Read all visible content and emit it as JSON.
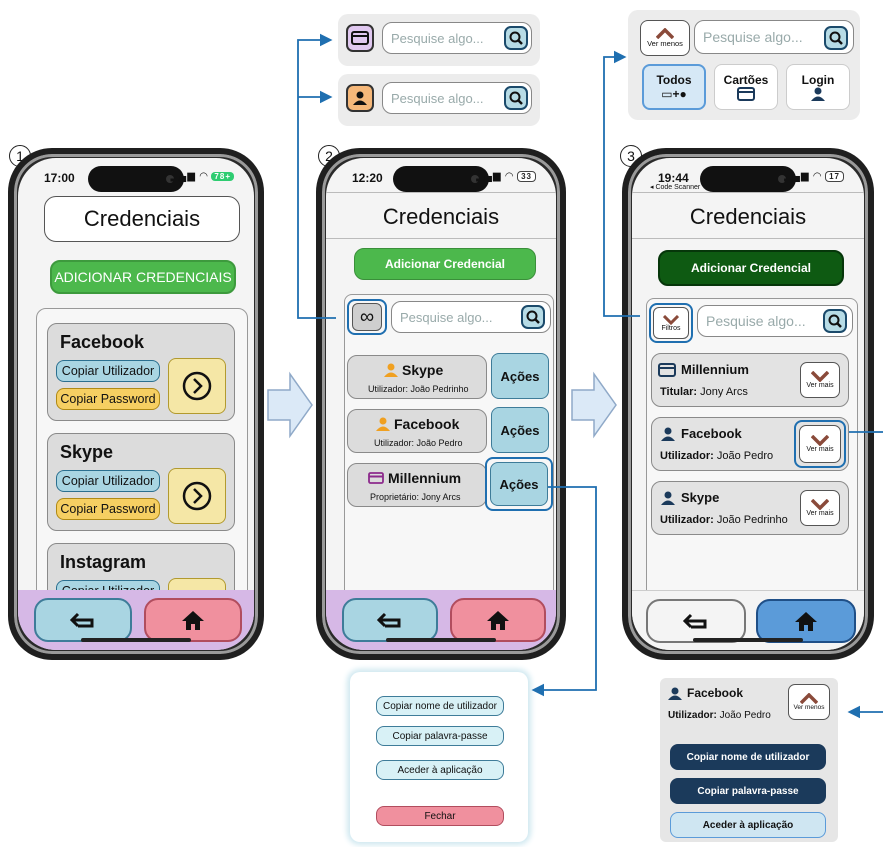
{
  "steps": {
    "s1": "1",
    "s2": "2",
    "s3": "3"
  },
  "phone1": {
    "time": "17:00",
    "battery": "78+",
    "title": "Credenciais",
    "add_button": "ADICIONAR CREDENCIAIS",
    "cards": [
      {
        "name": "Facebook",
        "copy_user": "Copiar Utilizador",
        "copy_pass": "Copiar Password"
      },
      {
        "name": "Skype",
        "copy_user": "Copiar Utilizador",
        "copy_pass": "Copiar Password"
      },
      {
        "name": "Instagram",
        "copy_user": "Copiar Utilizador"
      }
    ]
  },
  "phone2": {
    "time": "12:20",
    "battery": "33",
    "title": "Credenciais",
    "add_button": "Adicionar Credencial",
    "search_placeholder": "Pesquise algo...",
    "items": [
      {
        "name": "Skype",
        "sub": "Utilizador: João Pedrinho",
        "action": "Ações",
        "icon": "person-icon"
      },
      {
        "name": "Facebook",
        "sub": "Utilizador: João Pedro",
        "action": "Ações",
        "icon": "person-icon"
      },
      {
        "name": "Millennium",
        "sub": "Proprietário: Jony Arcs",
        "action": "Ações",
        "icon": "card-icon"
      }
    ]
  },
  "phone3": {
    "time": "19:44",
    "app_label": "◂ Code Scanner",
    "battery": "17",
    "title": "Credenciais",
    "add_button": "Adicionar Credencial",
    "filter_label": "Filtros",
    "search_placeholder": "Pesquise algo...",
    "more_label": "Ver mais",
    "items": [
      {
        "name": "Millennium",
        "label": "Titular:",
        "value": "Jony Arcs",
        "icon": "card-icon"
      },
      {
        "name": "Facebook",
        "label": "Utilizador:",
        "value": "João Pedro",
        "icon": "person-icon"
      },
      {
        "name": "Skype",
        "label": "Utilizador:",
        "value": "João Pedrinho",
        "icon": "person-icon"
      }
    ]
  },
  "callouts": {
    "search_placeholder": "Pesquise algo...",
    "less_label": "Ver menos",
    "filters": [
      "Todos",
      "Cartões",
      "Login"
    ],
    "actions_menu": [
      "Copiar nome de utilizador",
      "Copiar palavra-passe",
      "Aceder à aplicação",
      "Fechar"
    ],
    "expanded": {
      "name": "Facebook",
      "label": "Utilizador:",
      "value": "João Pedro",
      "less_label": "Ver menos",
      "buttons": [
        "Copiar nome de utilizador",
        "Copiar palavra-passe",
        "Aceder à aplicação"
      ]
    }
  },
  "colors": {
    "green": "#4cb84c",
    "dark_green": "#0e5a12",
    "blue": "#1f6fb0",
    "yellow": "#f5e7a6",
    "pink": "#f0909e",
    "lightblue": "#a9d5e2"
  }
}
